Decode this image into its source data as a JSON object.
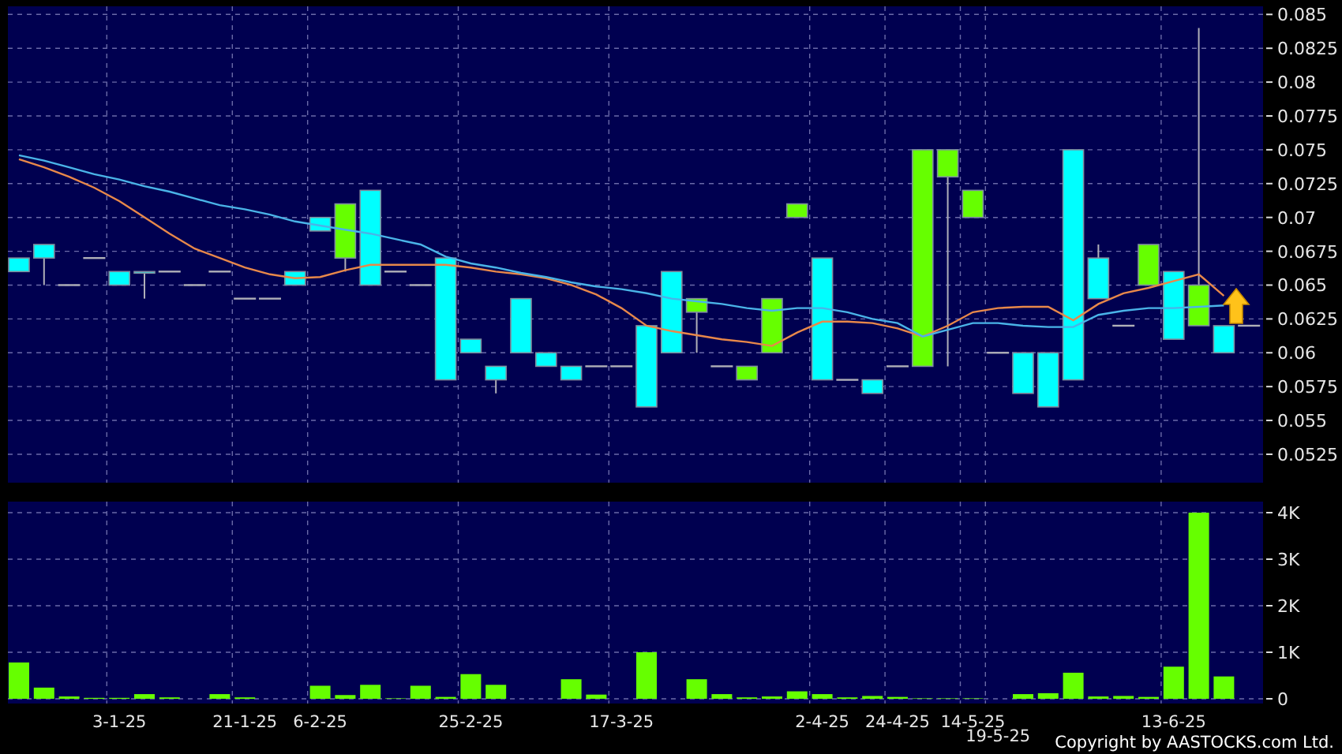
{
  "price_chart": {
    "chart_data": {
      "type": "line",
      "grid": true,
      "ylim": [
        0.0504,
        0.0856
      ],
      "yticks": [
        0.0525,
        0.055,
        0.0575,
        0.06,
        0.0625,
        0.065,
        0.0675,
        0.07,
        0.0725,
        0.075,
        0.0775,
        0.08,
        0.0825,
        0.085
      ],
      "series": [
        {
          "color": "#e8884a",
          "values": [
            0.0743,
            0.0737,
            0.073,
            0.0722,
            0.0712,
            0.07,
            0.0688,
            0.0677,
            0.067,
            0.0663,
            0.0658,
            0.0655,
            0.0656,
            0.0661,
            0.0665,
            0.0665,
            0.0665,
            0.0665,
            0.0663,
            0.066,
            0.0658,
            0.0655,
            0.065,
            0.0643,
            0.0633,
            0.062,
            0.0616,
            0.0613,
            0.061,
            0.0608,
            0.0605,
            0.0615,
            0.0623,
            0.0623,
            0.0622,
            0.0618,
            0.0612,
            0.062,
            0.063,
            0.0633,
            0.0634,
            0.0634,
            0.0624,
            0.0636,
            0.0644,
            0.0648,
            0.0653,
            0.0658,
            0.0642,
            null
          ]
        },
        {
          "color": "#4ab4e8",
          "values": [
            0.0746,
            0.0742,
            0.0737,
            0.0732,
            0.0728,
            0.0723,
            0.0719,
            0.0714,
            0.0709,
            0.0706,
            0.0702,
            0.0697,
            0.0694,
            0.0691,
            0.0688,
            0.0684,
            0.068,
            0.0671,
            0.0666,
            0.0663,
            0.0659,
            0.0656,
            0.0652,
            0.0649,
            0.0647,
            0.0644,
            0.064,
            0.0638,
            0.0636,
            0.0633,
            0.0631,
            0.0633,
            0.0633,
            0.063,
            0.0625,
            0.0622,
            0.0612,
            0.0617,
            0.0622,
            0.0622,
            0.062,
            0.0619,
            0.0619,
            0.0628,
            0.0631,
            0.0633,
            0.0633,
            0.0634,
            0.0635,
            null
          ]
        }
      ]
    }
  },
  "volume_chart": {
    "chart_data": {
      "type": "bar",
      "grid": true,
      "categories": [
        null,
        null,
        null,
        null,
        "3-1-25",
        null,
        null,
        null,
        null,
        "21-1-25",
        null,
        null,
        "6-2-25",
        null,
        null,
        null,
        null,
        null,
        "25-2-25",
        null,
        null,
        null,
        null,
        null,
        "17-3-25",
        null,
        null,
        null,
        null,
        null,
        null,
        null,
        "2-4-25",
        null,
        null,
        "24-4-25",
        null,
        null,
        "14-5-25",
        "19-5-25",
        null,
        null,
        null,
        null,
        null,
        null,
        "13-6-25",
        null,
        null,
        null
      ],
      "ylim": [
        -102,
        4237
      ],
      "yticks": [
        {
          "value": 0,
          "label": "0"
        },
        {
          "value": 1000,
          "label": "1K"
        },
        {
          "value": 2000,
          "label": "2K"
        },
        {
          "value": 3000,
          "label": "3K"
        },
        {
          "value": 4000,
          "label": "4K"
        }
      ],
      "series": [
        {
          "color": "#66ff00",
          "values": [
            780,
            240,
            50,
            20,
            20,
            100,
            30,
            0,
            100,
            30,
            0,
            0,
            280,
            80,
            300,
            10,
            280,
            40,
            530,
            300,
            0,
            0,
            420,
            90,
            0,
            1000,
            0,
            420,
            100,
            30,
            50,
            160,
            100,
            30,
            60,
            40,
            10,
            10,
            10,
            0,
            100,
            120,
            560,
            50,
            60,
            40,
            690,
            4000,
            480,
            0
          ]
        }
      ]
    }
  },
  "copyright": "Copyright by AASTOCKS.com Ltd."
}
